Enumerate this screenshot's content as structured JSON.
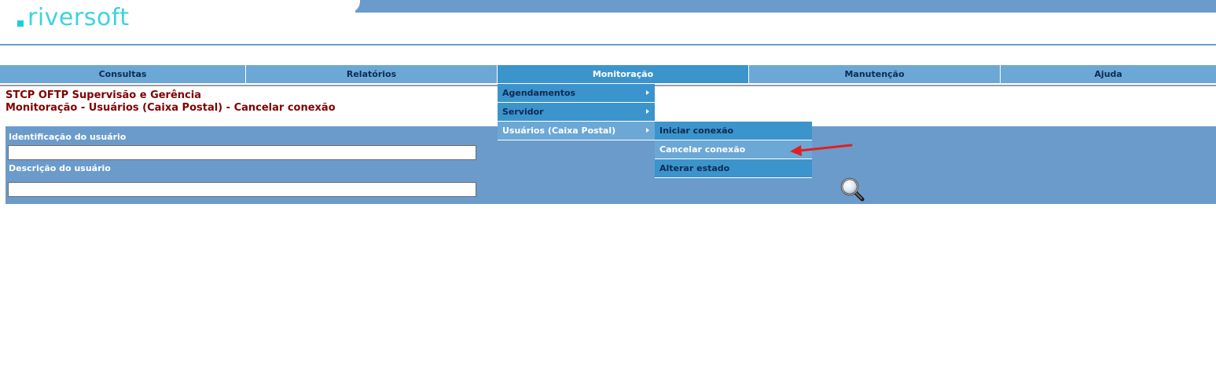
{
  "brand": {
    "logo_text": "riversoft"
  },
  "menubar": {
    "items": [
      {
        "label": "Consultas"
      },
      {
        "label": "Relatórios"
      },
      {
        "label": "Monitoração"
      },
      {
        "label": "Manutenção"
      },
      {
        "label": "Ajuda"
      }
    ],
    "active": "Monitoração"
  },
  "page": {
    "title": "STCP OFTP Supervisão e Gerência",
    "subtitle": "Monitoração - Usuários (Caixa Postal) - Cancelar conexão"
  },
  "form": {
    "user_id_label": "Identificação do usuário",
    "user_id_value": "",
    "user_desc_label": "Descrição do usuário",
    "user_desc_value": ""
  },
  "dropdown_monitoracao": {
    "items": [
      {
        "label": "Agendamentos"
      },
      {
        "label": "Servidor"
      },
      {
        "label": "Usuários (Caixa Postal)"
      }
    ]
  },
  "submenu_usuarios": {
    "items": [
      {
        "label": "Iniciar conexão"
      },
      {
        "label": "Cancelar conexão"
      },
      {
        "label": "Alterar estado"
      }
    ]
  },
  "icons": {
    "search": "magnifier-icon",
    "pointer": "red-arrow-annotation"
  },
  "colors": {
    "menu_bg": "#6ba8d6",
    "menu_active": "#3c94cc",
    "title": "#800000",
    "panel": "#6b9bcb",
    "logo": "#3ed3e0"
  }
}
